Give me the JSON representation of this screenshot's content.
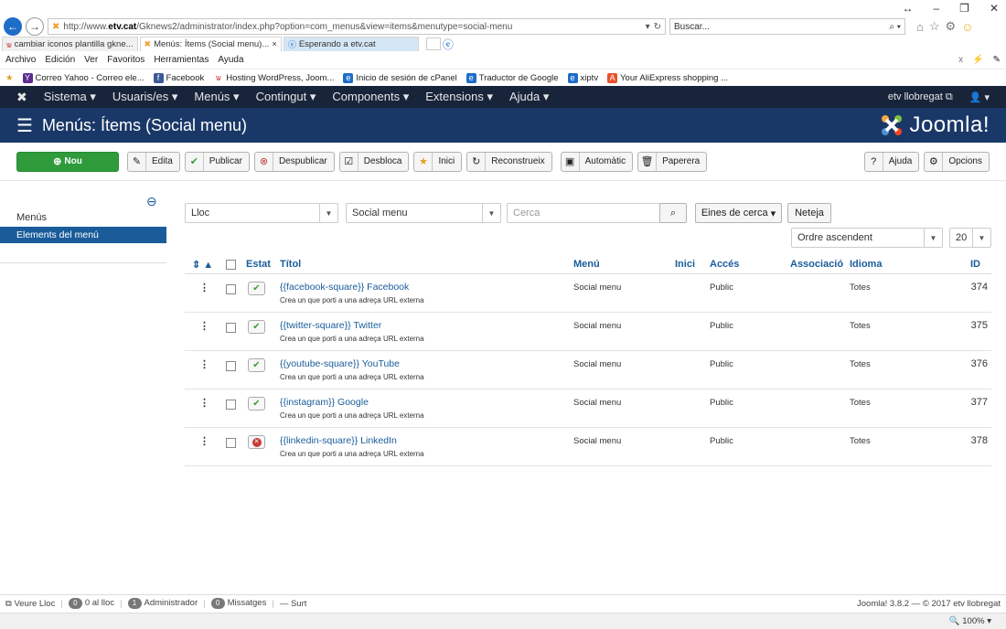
{
  "browser": {
    "address": {
      "prefix": "http://www.",
      "domain": "etv.cat",
      "path": "/Gknews2/administrator/index.php?option=com_menus&view=items&menutype=social-menu"
    },
    "search_placeholder": "Buscar...",
    "tabs": [
      {
        "label": "cambiar iconos plantilla gkne..."
      },
      {
        "label": "Menús: Ítems (Social menu)...",
        "active": true
      },
      {
        "label": "Esperando a etv.cat"
      }
    ],
    "menu": [
      "Archivo",
      "Edición",
      "Ver",
      "Favoritos",
      "Herramientas",
      "Ayuda"
    ],
    "bookmarks": [
      "Correo Yahoo - Correo ele...",
      "Facebook",
      "Hosting WordPress, Joom...",
      "Inicio de sesión de cPanel",
      "Traductor de Google",
      "xiptv",
      "Your AliExpress shopping ..."
    ],
    "zoom": "100%"
  },
  "nav": {
    "items": [
      "Sistema",
      "Usuaris/es",
      "Menús",
      "Contingut",
      "Components",
      "Extensions",
      "Ajuda"
    ],
    "site": "etv llobregat"
  },
  "header": {
    "title": "Menús: Ítems (Social menu)",
    "brand": "Joomla!"
  },
  "toolbar": {
    "new": "Nou",
    "edit": "Edita",
    "publish": "Publicar",
    "unpublish": "Despublicar",
    "checkin": "Desbloca",
    "home": "Inici",
    "rebuild": "Reconstrueix",
    "auto": "Automàtic",
    "trash": "Paperera",
    "help": "Ajuda",
    "options": "Opcions"
  },
  "sidebar": {
    "heading": "Menús",
    "item": "Elements del menú"
  },
  "filters": {
    "site_select": "Lloc",
    "menu_select": "Social menu",
    "search_placeholder": "Cerca",
    "tools": "Eines de cerca",
    "clear": "Neteja",
    "order": "Ordre ascendent",
    "limit": "20"
  },
  "table": {
    "headers": {
      "status": "Estat",
      "title": "Títol",
      "menu": "Menú",
      "home": "Inici",
      "access": "Accés",
      "assoc": "Associació",
      "lang": "Idioma",
      "id": "ID"
    },
    "rows": [
      {
        "title": "{{facebook-square}} Facebook",
        "sub": "Crea un que porti a una adreça URL externa",
        "menu": "Social menu",
        "access": "Public",
        "lang": "Totes",
        "id": "374",
        "published": true
      },
      {
        "title": "{{twitter-square}} Twitter",
        "sub": "Crea un que porti a una adreça URL externa",
        "menu": "Social menu",
        "access": "Public",
        "lang": "Totes",
        "id": "375",
        "published": true
      },
      {
        "title": "{{youtube-square}} YouTube",
        "sub": "Crea un que porti a una adreça URL externa",
        "menu": "Social menu",
        "access": "Public",
        "lang": "Totes",
        "id": "376",
        "published": true
      },
      {
        "title": "{{instagram}} Google",
        "sub": "Crea un que porti a una adreça URL externa",
        "menu": "Social menu",
        "access": "Public",
        "lang": "Totes",
        "id": "377",
        "published": true
      },
      {
        "title": "{{linkedin-square}} LinkedIn",
        "sub": "Crea un que porti a una adreça URL externa",
        "menu": "Social menu",
        "access": "Public",
        "lang": "Totes",
        "id": "378",
        "published": false
      }
    ]
  },
  "footer": {
    "view_site": "Veure Lloc",
    "visitors_count": "0",
    "visitors": "0 al lloc",
    "admins_count": "1",
    "admins": "Administrador",
    "msg_count": "0",
    "messages": "Missatges",
    "logout": "Surt",
    "version": "Joomla! 3.8.2 — © 2017 etv llobregat"
  }
}
